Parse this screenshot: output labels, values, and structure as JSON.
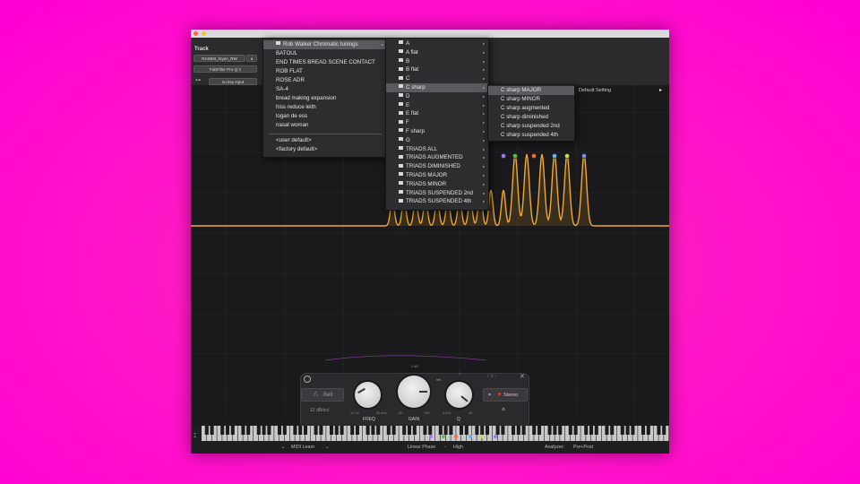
{
  "header": {
    "track_label": "Track",
    "track_name": "RAINMI_hryen_RW",
    "track_btn": "a",
    "plugin_name": "FabFilter Pro-Q 3",
    "key_input": "no key input"
  },
  "preset_menu": {
    "header_item": "Rob Walker Chromatic tunings",
    "items": [
      "BATOUL",
      "END TIMES BREAD SCENE CONTACT",
      "ROB FLAT",
      "ROSE ADR",
      "SA-4",
      "bread making expansion",
      "hiss reduce leith",
      "logan de ess",
      "nasal woman"
    ],
    "footer_items": [
      "<user default>",
      "<factory default>"
    ]
  },
  "key_menu": {
    "items": [
      "A",
      "A flat",
      "B",
      "B flat",
      "C",
      "C sharp",
      "D",
      "E",
      "E flat",
      "F",
      "F sharp",
      "G",
      "TRIADS ALL",
      "TRIADS AUGMENTED",
      "TRIADS DIMINISHED",
      "TRIADS MAJOR",
      "TRIADS MINOR",
      "TRIADS SUSPENDED 2nd",
      "TRIADS SUSPENDED 4th"
    ],
    "selected_index": 5
  },
  "chord_menu": {
    "items": [
      "C sharp MAJOR",
      "C sharp MINOR",
      "C sharp augmented",
      "C sharp diminished",
      "C sharp suspended 2nd",
      "C sharp suspended 4th"
    ],
    "selected_index": 0
  },
  "default_setting": "Default Setting",
  "band_panel": {
    "shape_label": "Bell",
    "slope": "12 dB/oct",
    "stereo_label": "Stereo",
    "freq_label": "FREQ",
    "gain_label": "GAIN",
    "q_label": "Q",
    "freq_min": "10 Hz",
    "freq_max": "30 kHz",
    "gain_min": "-30",
    "gain_max": "+30",
    "q_min": "0.025",
    "q_max": "40",
    "gain_top": "0 dB",
    "q_top": "1"
  },
  "bottom_bar": {
    "midi_learn": "MIDI Learn",
    "phase_mode": "Linear Phase",
    "quality": "High",
    "analyzer_label": "Analyzer:",
    "analyzer_value": "Pre+Post"
  },
  "eq_nodes": {
    "colors": [
      "#9b7bff",
      "#58c04a",
      "#ff6a3a",
      "#5ab6ff",
      "#c8e04b",
      "#7a8cff"
    ]
  },
  "colors": {
    "curve": "#f0a830",
    "background": "#ff10c8"
  }
}
